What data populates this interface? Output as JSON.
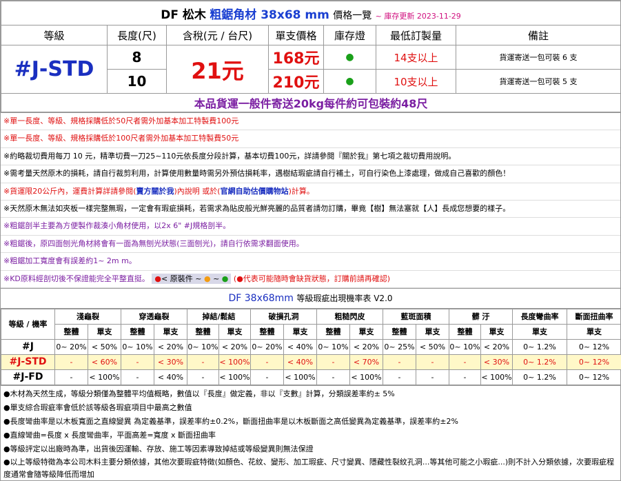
{
  "title": {
    "prefix": "DF 松木",
    "highlight": "粗鋸角材 38x68 mm",
    "suffix": "價格一覽",
    "update": "~ 庫存更新 2023-11-29"
  },
  "headers": [
    "等級",
    "長度(尺)",
    "含稅(元 / 台尺)",
    "單支價格",
    "庫存燈",
    "最低訂製量",
    "備註"
  ],
  "grade": "#J-STD",
  "price_per_tai_chi": "21元",
  "rows": [
    {
      "length": "8",
      "unit_price": "168元",
      "stock": "●",
      "min_qty": "14支以上",
      "remark": "貨運寄送一包可裝 6 支"
    },
    {
      "length": "10",
      "unit_price": "210元",
      "stock": "●",
      "min_qty": "10支以上",
      "remark": "貨運寄送一包可裝 5 支"
    }
  ],
  "shipping_note": "本品貨運一般件寄送20kg每件約可包裝約48尺",
  "notes": [
    {
      "text": "※單一長度、等級、規格採購低於50尺者需外加基本加工特製費100元",
      "color": "red"
    },
    {
      "text": "※單一長度、等級、規格採購低於100尺者需外加基本加工特製費50元",
      "color": "red"
    },
    {
      "text": "※約略裁切費用每刀 10 元，精準切費一刀25~110元依長度分段計算，基本切費100元，詳請參閱『關於我』第七項之裁切費用說明。",
      "color": "black"
    },
    {
      "text": "※需考量天然原木的損耗，請自行裁剪利用，計算使用數量時需另外預估損耗率，遇樹結瑕疵請自行補土，可自行染色上漆處理，做成自己喜歡的顏色！",
      "color": "black"
    },
    {
      "text_a": "※貨運限20公斤內，運費計算詳請參閱(",
      "link_a": "賣方關於我",
      "text_b": ")內說明 或於(",
      "link_b": "官網自助估價購物站",
      "text_c": ")計算。",
      "color": "red"
    },
    {
      "text": "※天然原木無法如夾板一樣完整無瑕，一定會有瑕疵損耗，若需求為貼皮般光鮮亮麗的品質者請勿訂購，畢竟【樹】無法塞就【人】長成您想要的樣子。",
      "color": "black"
    },
    {
      "text": "※粗鋸剖半主要為方便製作裁湊小角材使用，以2x 6\" #J規格剖半。",
      "color": "purple"
    },
    {
      "text": "※粗鋸後，原四面刨光角材將會有一面為無刨光狀態(三面刨光)，請自行依需求翻面使用。",
      "color": "purple"
    },
    {
      "text": "※粗鋸加工寬度會有誤差約1~ 2m m。",
      "color": "purple"
    },
    {
      "text_a": "※KD原料經剖切後不保證能完全平整直挺。",
      "legend": "< 原裝件  ~  ",
      "legend_tail": "(",
      "legend_note": "代表可能隨時會缺貨狀態，訂購前請再確認)",
      "color": "purple"
    }
  ],
  "defect": {
    "title": "DF 38x68mm",
    "subtitle": "等級瑕疵出現機率表 V2.0",
    "corner": "等級 / 機率",
    "categories": [
      "淺龜裂",
      "穿透龜裂",
      "掉結/鬆結",
      "破損孔洞",
      "粗糙閃皮",
      "藍斑面積",
      "髒 汙"
    ],
    "sub_headers": [
      "整體",
      "單支"
    ],
    "extra_categories": [
      "長度彎曲率",
      "斷面扭曲率"
    ],
    "extra_sub": "單支",
    "rows": [
      {
        "grade": "#J",
        "values": [
          "0~ 20%",
          "< 50%",
          "0~ 10%",
          "< 20%",
          "0~ 10%",
          "< 20%",
          "0~ 20%",
          "< 40%",
          "0~ 10%",
          "< 20%",
          "0~ 25%",
          "< 50%",
          "0~ 10%",
          "< 20%",
          "0~ 1.2%",
          "0~ 12%"
        ]
      },
      {
        "grade": "#J-STD",
        "values": [
          "-",
          "< 60%",
          "-",
          "< 30%",
          "-",
          "< 100%",
          "-",
          "< 40%",
          "-",
          "< 70%",
          "-",
          "-",
          "-",
          "< 30%",
          "0~ 1.2%",
          "0~ 12%"
        ]
      },
      {
        "grade": "#J-FD",
        "values": [
          "-",
          "< 100%",
          "-",
          "< 40%",
          "-",
          "< 100%",
          "-",
          "< 100%",
          "-",
          "< 100%",
          "-",
          "-",
          "-",
          "< 100%",
          "0~ 1.2%",
          "0~ 12%"
        ]
      }
    ]
  },
  "footer_notes": [
    "●木材為天然生成，等級分類僅為整體平均值概略，數值以『長度』做定義，非以『支數』計算，分類誤差率約± 5%",
    "●單支綜合瑕疵率會低於該等級各瑕疵項目中最高之數值",
    "●長度彎曲率是以木板寬面之直線變異 為定義基準，誤差率約±0.2%，斷面扭曲率是以木板斷面之高低變異為定義基準，誤差率約±2%",
    "●直線彎曲=長度 x 長度彎曲率，平面高差=寬度 x 斷面扭曲率",
    "●等級評定以出廠時為準，出貨後因運輸、存放、施工等因素導致掉結或等級變異則無法保證",
    "●以上等級特徵為本公司木料主要分類依據，其他次要瑕疵特徵(如顏色、花紋、變形、加工瑕疵、尺寸變異、隱藏性裂紋孔洞...等其他可能之小瑕疵...)則不計入分類依據，次要瑕疵程度通常會隨等級降低而增加"
  ]
}
